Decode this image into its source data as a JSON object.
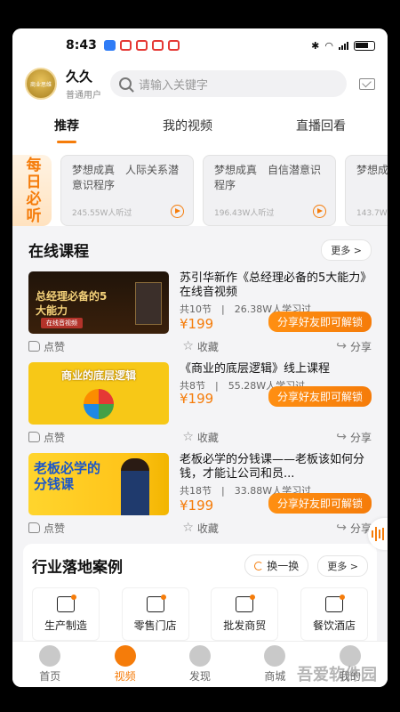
{
  "status": {
    "time": "8:43"
  },
  "user": {
    "name": "久久",
    "role": "普通用户",
    "avatar_text": "商业思维"
  },
  "search": {
    "placeholder": "请输入关键字"
  },
  "tabs": [
    "推荐",
    "我的视频",
    "直播回看"
  ],
  "daily": {
    "tag": "每日必听",
    "cards": [
      {
        "title": "梦想成真　人际关系潜意识程序",
        "listeners": "245.55W人听过"
      },
      {
        "title": "梦想成真　自信潜意识程序",
        "listeners": "196.43W人听过"
      },
      {
        "title": "梦想成真",
        "listeners": "143.7W"
      }
    ]
  },
  "online": {
    "title": "在线课程",
    "more": "更多 >",
    "courses": [
      {
        "title": "苏引华新作《总经理必备的5大能力》在线音视频",
        "sections": "共10节",
        "learners": "26.38W人学习过",
        "price": "¥199",
        "unlock": "分享好友即可解锁",
        "like": "点赞",
        "fav": "收藏",
        "share": "分享",
        "thumb_text": "总经理必备的5大能力",
        "thumb_sub": "在线音视频"
      },
      {
        "title": "《商业的底层逻辑》线上课程",
        "sections": "共8节",
        "learners": "55.28W人学习过",
        "price": "¥199",
        "unlock": "分享好友即可解锁",
        "like": "点赞",
        "fav": "收藏",
        "share": "分享",
        "thumb_text": "商业的底层逻辑",
        "thumb_sub": ""
      },
      {
        "title": "老板必学的分钱课——老板该如何分钱，才能让公司和员...",
        "sections": "共18节",
        "learners": "33.88W人学习过",
        "price": "¥199",
        "unlock": "分享好友即可解锁",
        "like": "点赞",
        "fav": "收藏",
        "share": "分享",
        "thumb_text": "老板必学的分钱课",
        "thumb_sub": ""
      }
    ]
  },
  "cases": {
    "title": "行业落地案例",
    "swap": "换一换",
    "more": "更多 >",
    "items": [
      "生产制造",
      "零售门店",
      "批发商贸",
      "餐饮酒店"
    ]
  },
  "nav": [
    "首页",
    "视频",
    "发现",
    "商城",
    "我的"
  ],
  "watermark": "吾爱软件园",
  "colors": {
    "accent": "#f57c0a"
  }
}
